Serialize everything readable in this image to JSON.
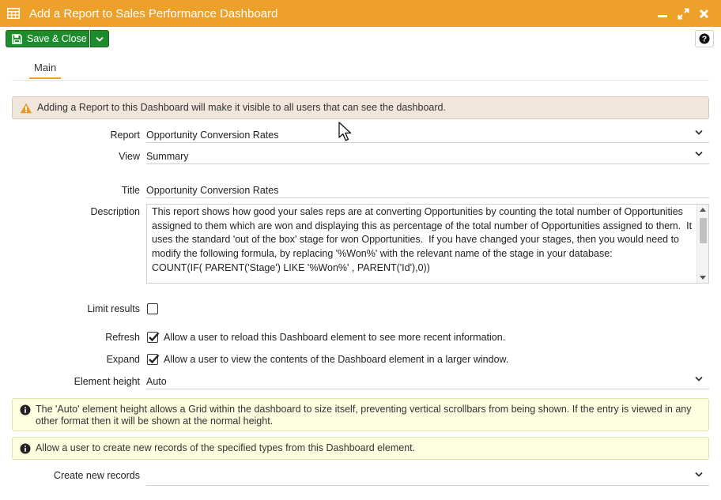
{
  "window": {
    "title": "Add a Report to Sales Performance Dashboard",
    "title_icon": "table-grid-icon",
    "controls": [
      "minimize-icon",
      "maximize-icon",
      "close-icon"
    ]
  },
  "toolbar": {
    "save_close_label": "Save & Close",
    "help_label": "?"
  },
  "tabs": [
    {
      "label": "Main",
      "active": true
    }
  ],
  "warning_text": "Adding a Report to this Dashboard will make it visible to all users that can see the dashboard.",
  "form": {
    "report": {
      "label": "Report",
      "value": "Opportunity Conversion Rates"
    },
    "view": {
      "label": "View",
      "value": "Summary"
    },
    "title": {
      "label": "Title",
      "value": "Opportunity Conversion Rates"
    },
    "description": {
      "label": "Description",
      "value": "This report shows how good your sales reps are at converting Opportunities by counting the total number of Opportunities assigned to them which are won and displaying this as percentage of the total number of Opportunities assigned to them.  It uses the standard 'out of the box' stage for won Opportunities.  If you have changed your stages, then you would need to modify the following formula, by replacing '%Won%' with the relevant name of the stage in your database:\nCOUNT(IF( PARENT('Stage') LIKE '%Won%' , PARENT('Id'),0))"
    },
    "limit_results": {
      "label": "Limit results",
      "checked": false
    },
    "refresh": {
      "label": "Refresh",
      "checked": true,
      "text": "Allow a user to reload this Dashboard element to see more recent information."
    },
    "expand": {
      "label": "Expand",
      "checked": true,
      "text": "Allow a user to view the contents of the Dashboard element in a larger window."
    },
    "element_height": {
      "label": "Element height",
      "value": "Auto"
    },
    "create_new_records": {
      "label": "Create new records",
      "value": ""
    }
  },
  "info_height_text": "The 'Auto' element height allows a Grid within the dashboard to size itself, preventing vertical scrollbars from being shown. If the entry is viewed in any other format then it will be shown at the normal height.",
  "info_create_text": "Allow a user to create new records of the specified types from this Dashboard element.",
  "colors": {
    "titlebar": "#eda12b",
    "save_button": "#1e8b2c",
    "warning_bg": "#f0e6dc",
    "info_bg": "#fdfde0"
  }
}
